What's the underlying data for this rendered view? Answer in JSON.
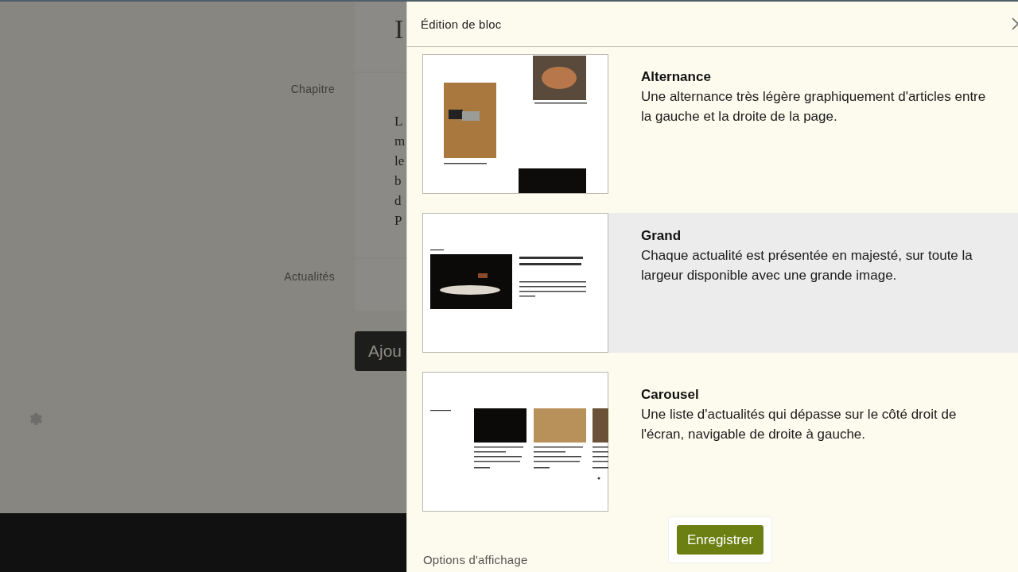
{
  "page_behind": {
    "heading_fragment": "I",
    "sections": [
      {
        "label": "Chapitre",
        "text_fragments": [
          "L",
          "m",
          "le",
          "b",
          "d",
          "P"
        ]
      },
      {
        "label": "Actualités"
      }
    ],
    "add_button": "Ajou"
  },
  "dialog": {
    "title": "Édition de bloc",
    "layouts": [
      {
        "kind": "alternance",
        "title": "Alternance",
        "description": "Une alternance très légère graphiquement d'articles entre la gauche et la droite de la page.",
        "selected": false
      },
      {
        "kind": "grand",
        "title": "Grand",
        "description": "Chaque actualité est présentée en majesté, sur toute la largeur disponible avec une grande image.",
        "selected": true
      },
      {
        "kind": "carousel",
        "title": "Carousel",
        "description": "Une liste d'actualités qui dépasse sur le côté droit de l'écran, navigable de droite à gauche.",
        "selected": false
      }
    ],
    "save_button": "Enregistrer",
    "section_heading": "Options d'affichage"
  }
}
